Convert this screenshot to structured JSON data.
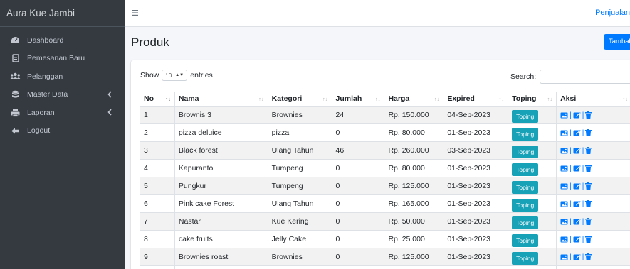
{
  "brand": "Aura Kue Jambi",
  "sidebar": {
    "items": [
      {
        "label": "Dashboard",
        "icon": "tachometer-icon"
      },
      {
        "label": "Pemesanan Baru",
        "icon": "file-icon"
      },
      {
        "label": "Pelanggan",
        "icon": "users-icon"
      },
      {
        "label": "Master Data",
        "icon": "database-icon"
      },
      {
        "label": "Laporan",
        "icon": "print-icon"
      },
      {
        "label": "Logout",
        "icon": "sign-out-icon"
      }
    ]
  },
  "topbar": {
    "link": "Penjualan"
  },
  "page": {
    "title": "Produk",
    "add_button": "Tambah"
  },
  "table_controls": {
    "show": "Show",
    "length_value": "10",
    "entries": "entries",
    "search_label": "Search:"
  },
  "table": {
    "headers": [
      "No",
      "Nama",
      "Kategori",
      "Jumlah",
      "Harga",
      "Expired",
      "Toping",
      "Aksi"
    ],
    "toping_label": "Toping",
    "rows": [
      {
        "no": "1",
        "nama": "Brownis 3",
        "kategori": "Brownies",
        "jumlah": "24",
        "harga": "Rp. 150.000",
        "expired": "04-Sep-2023"
      },
      {
        "no": "2",
        "nama": "pizza deluice",
        "kategori": "pizza",
        "jumlah": "0",
        "harga": "Rp. 80.000",
        "expired": "01-Sep-2023"
      },
      {
        "no": "3",
        "nama": "Black forest",
        "kategori": "Ulang Tahun",
        "jumlah": "46",
        "harga": "Rp. 260.000",
        "expired": "03-Sep-2023"
      },
      {
        "no": "4",
        "nama": "Kapuranto",
        "kategori": "Tumpeng",
        "jumlah": "0",
        "harga": "Rp. 80.000",
        "expired": "01-Sep-2023"
      },
      {
        "no": "5",
        "nama": "Pungkur",
        "kategori": "Tumpeng",
        "jumlah": "0",
        "harga": "Rp. 125.000",
        "expired": "01-Sep-2023"
      },
      {
        "no": "6",
        "nama": "Pink cake Forest",
        "kategori": "Ulang Tahun",
        "jumlah": "0",
        "harga": "Rp. 165.000",
        "expired": "01-Sep-2023"
      },
      {
        "no": "7",
        "nama": "Nastar",
        "kategori": "Kue Kering",
        "jumlah": "0",
        "harga": "Rp. 50.000",
        "expired": "01-Sep-2023"
      },
      {
        "no": "8",
        "nama": "cake fruits",
        "kategori": "Jelly Cake",
        "jumlah": "0",
        "harga": "Rp. 25.000",
        "expired": "01-Sep-2023"
      },
      {
        "no": "9",
        "nama": "Brownies roast",
        "kategori": "Brownies",
        "jumlah": "0",
        "harga": "Rp. 125.000",
        "expired": "01-Sep-2023"
      }
    ]
  },
  "colors": {
    "sidebar": "#343a40",
    "primary": "#007bff",
    "info": "#17a2b8"
  }
}
